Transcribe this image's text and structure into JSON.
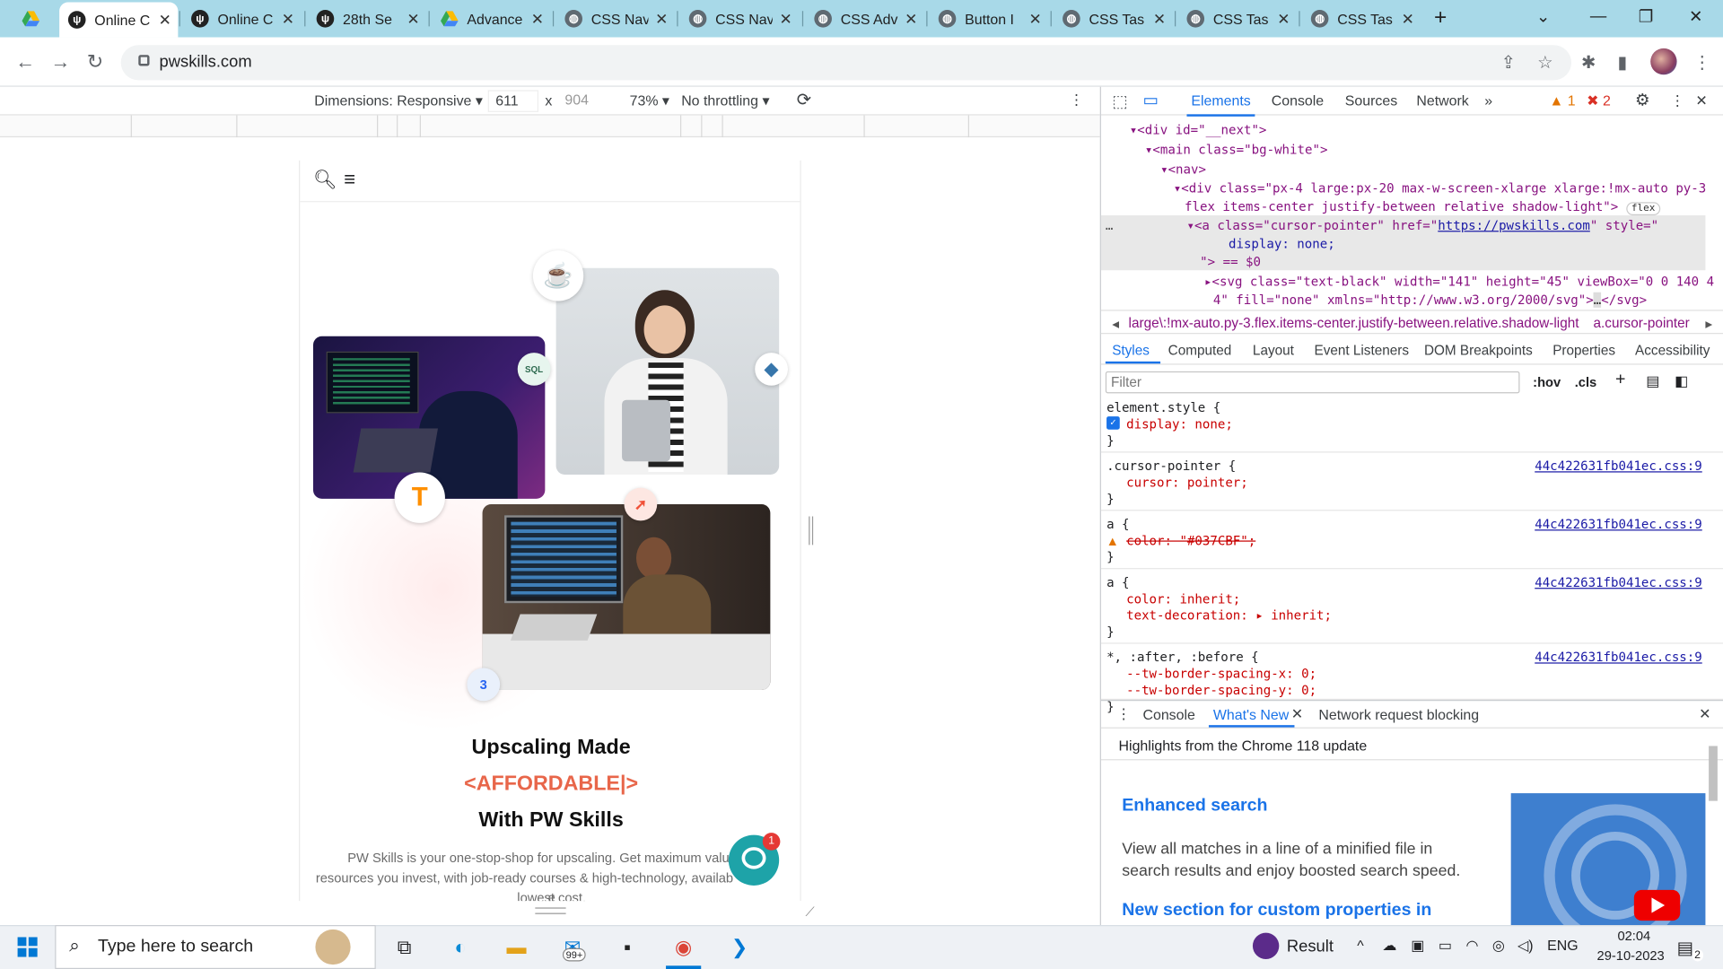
{
  "browser": {
    "tabs": [
      {
        "title": "",
        "favicon": "google-drive-icon"
      },
      {
        "title": "Online C",
        "favicon": "pw-skills-icon",
        "active": true
      },
      {
        "title": "Online C",
        "favicon": "pw-skills-icon"
      },
      {
        "title": "28th Se",
        "favicon": "pw-skills-icon"
      },
      {
        "title": "Advance",
        "favicon": "google-drive-icon"
      },
      {
        "title": "CSS Nav",
        "favicon": "globe-icon"
      },
      {
        "title": "CSS Nav",
        "favicon": "globe-icon"
      },
      {
        "title": "CSS Adv",
        "favicon": "globe-icon"
      },
      {
        "title": "Button I",
        "favicon": "globe-icon"
      },
      {
        "title": "CSS Tas",
        "favicon": "globe-icon"
      },
      {
        "title": "CSS Tas",
        "favicon": "globe-icon"
      },
      {
        "title": "CSS Tas",
        "favicon": "globe-icon"
      }
    ],
    "url": "pwskills.com"
  },
  "device_toolbar": {
    "dimensions": "Dimensions: Responsive",
    "width": "611",
    "height": "904",
    "x": "x",
    "zoom": "73%",
    "throttling": "No throttling"
  },
  "page": {
    "heading_1": "Upscaling Made",
    "heading_2": "<AFFORDABLE|>",
    "heading_3": "With PW Skills",
    "para_1": "PW Skills is your one-stop-shop for upscaling. Get maximum value for",
    "para_2": "resources you invest, with job-ready courses & high-technology, availab",
    "para_2_tail": "e",
    "para_3": "lowest cost.",
    "chat_count": "1",
    "badge_sql": "SQL",
    "accent": "#e8664a",
    "teal": "#1ea3a8"
  },
  "devtools": {
    "tabs": [
      "Elements",
      "Console",
      "Sources",
      "Network"
    ],
    "more_tabs": "»",
    "warnings": "1",
    "errors": "2",
    "dom": {
      "l1": "<div id=\"__next\">",
      "l2": "<main class=\"bg-white\">",
      "l3": "<nav>",
      "l4": "<div class=\"px-4 large:px-20 max-w-screen-xlarge xlarge:!mx-auto py-3",
      "l5": "flex items-center justify-between relative shadow-light\">",
      "l5_badge": "flex",
      "l6a": "<a class=\"cursor-pointer\" href=\"",
      "l6_link": "https://pwskills.com",
      "l6b": "\" style=\"",
      "l7": "display: none;",
      "l8": "\"> == $0",
      "l9": "<svg class=\"text-black\" width=\"141\" height=\"45\" viewBox=\"0 0 140 4",
      "l10": "4\" fill=\"none\" xmlns=\"http://www.w3.org/2000/svg\">",
      "l10_more": "…",
      "l10_end": "</svg>",
      "dots": "…"
    },
    "crumbs": {
      "part1": "large\\:!mx-auto.py-3.flex.items-center.justify-between.relative.shadow-light",
      "part2": "a.cursor-pointer"
    },
    "styles_tabs": [
      "Styles",
      "Computed",
      "Layout",
      "Event Listeners",
      "DOM Breakpoints",
      "Properties",
      "Accessibility"
    ],
    "filter_placeholder": "Filter",
    "hov": ":hov",
    "cls": ".cls",
    "rules": [
      {
        "selector": "element.style {",
        "props": [
          "display: none;"
        ],
        "src": ""
      },
      {
        "selector": ".cursor-pointer {",
        "props": [
          "cursor: pointer;"
        ],
        "src": "44c422631fb041ec.css:9"
      },
      {
        "selector": "a {",
        "props": [
          "color: \"#037CBF\";"
        ],
        "src": "44c422631fb041ec.css:9"
      },
      {
        "selector": "a {",
        "props": [
          "color: inherit;",
          "text-decoration: ▸ inherit;"
        ],
        "src": "44c422631fb041ec.css:9"
      },
      {
        "selector": "*, :after, :before {",
        "props": [
          "--tw-border-spacing-x: 0;",
          "--tw-border-spacing-y: 0;"
        ],
        "src": "44c422631fb041ec.css:9"
      }
    ],
    "close_brace": "}",
    "drawer_tabs": [
      "Console",
      "What's New",
      "Network request blocking"
    ],
    "whats_new": {
      "highlights": "Highlights from the Chrome 118 update",
      "title1": "Enhanced search",
      "text1": "View all matches in a line of a minified file in search results and enjoy boosted search speed.",
      "title2": "New section for custom properties in"
    }
  },
  "taskbar": {
    "search_placeholder": "Type here to search",
    "mail_badge": "99+",
    "result": "Result",
    "lang": "ENG",
    "time": "02:04",
    "date": "29-10-2023",
    "notif": "2"
  }
}
